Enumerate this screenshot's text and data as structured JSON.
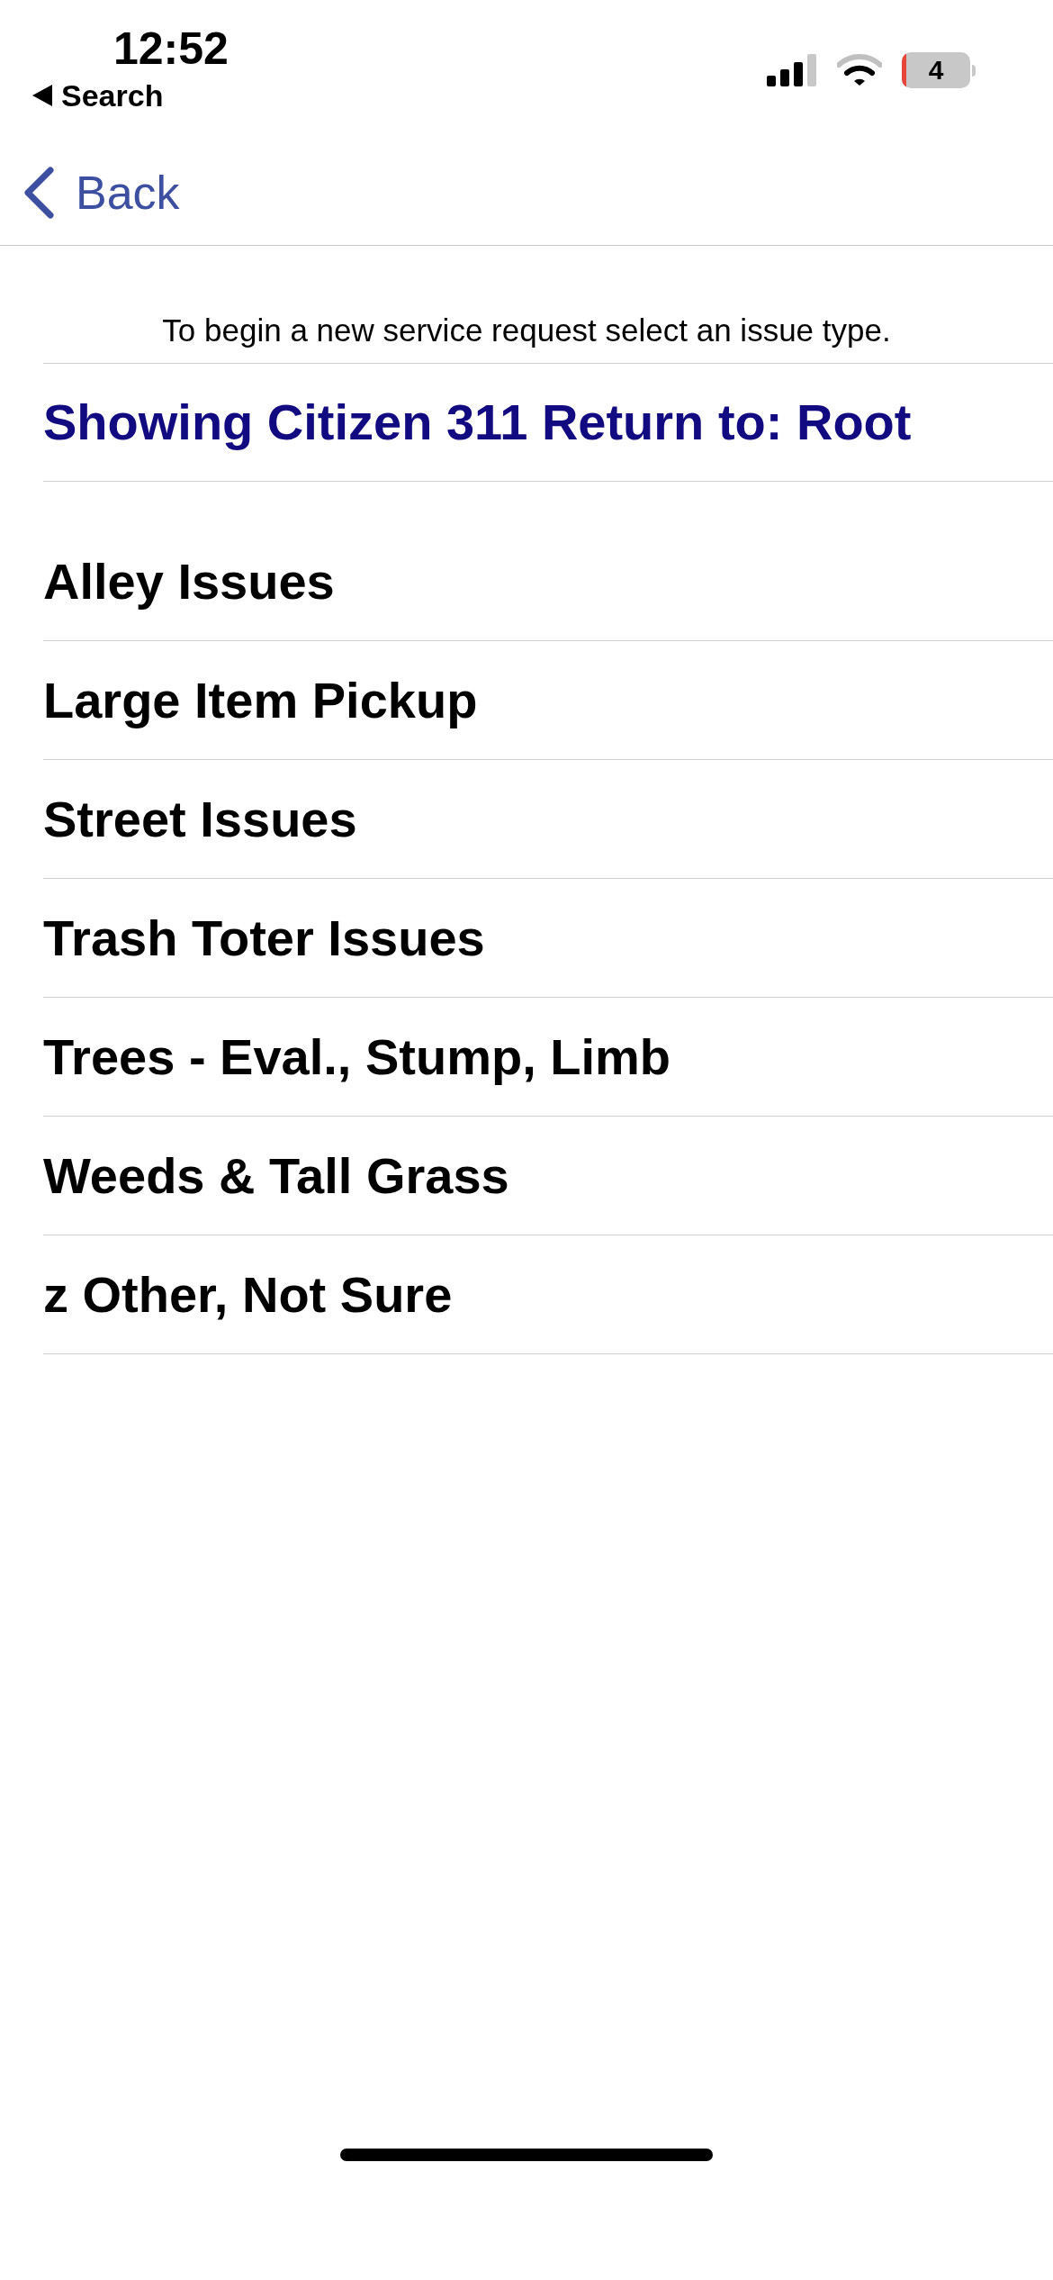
{
  "status_bar": {
    "time": "12:52",
    "back_label": "Search",
    "battery": "4"
  },
  "nav": {
    "back": "Back"
  },
  "intro": "To begin a new service request select an issue type.",
  "heading": "Showing Citizen 311 Return to: Root",
  "issues": [
    {
      "label": "Alley Issues"
    },
    {
      "label": "Large Item Pickup"
    },
    {
      "label": "Street Issues"
    },
    {
      "label": "Trash Toter Issues"
    },
    {
      "label": "Trees - Eval., Stump, Limb"
    },
    {
      "label": "Weeds & Tall Grass"
    },
    {
      "label": "z Other, Not Sure"
    }
  ]
}
